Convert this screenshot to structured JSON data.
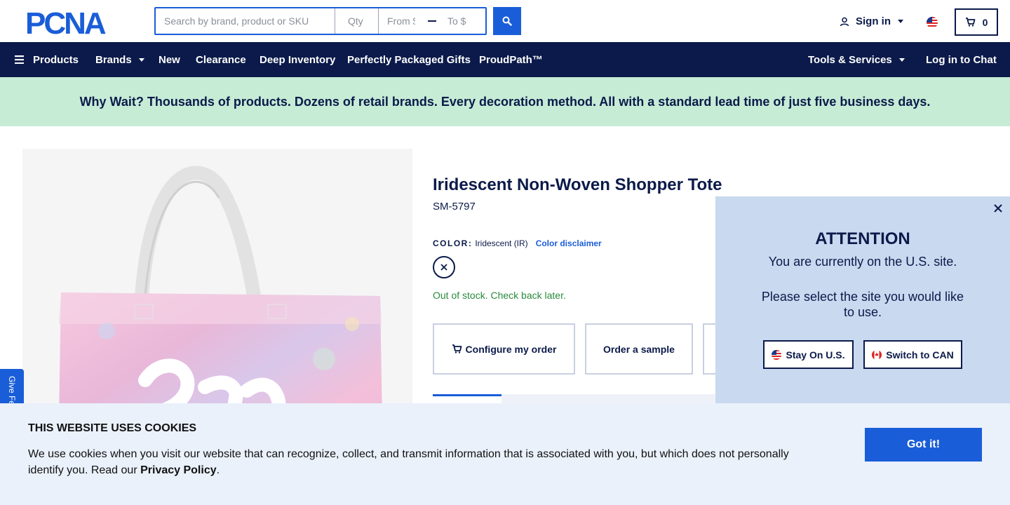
{
  "header": {
    "logo_text": "PCNA",
    "search_placeholder": "Search by brand, product or SKU",
    "qty_placeholder": "Qty",
    "from_placeholder": "From $",
    "to_placeholder": "To $",
    "sign_in": "Sign in",
    "cart_count": "0"
  },
  "nav": {
    "products": "Products",
    "brands": "Brands",
    "new": "New",
    "clearance": "Clearance",
    "deep_inventory": "Deep Inventory",
    "gifts": "Perfectly Packaged Gifts",
    "proudpath": "ProudPath™",
    "tools": "Tools & Services",
    "chat": "Log in to Chat"
  },
  "banner": {
    "text": "Why Wait? Thousands of products. Dozens of retail brands. Every decoration method. All with a standard lead time of just five business days."
  },
  "product": {
    "title": "Iridescent Non-Woven Shopper Tote",
    "sku": "SM-5797",
    "color_label": "COLOR:",
    "color_value": "Iridescent (IR)",
    "color_disclaimer": "Color disclaimer",
    "stock_status": "Out of stock. Check back later.",
    "configure_button": "Configure my order",
    "sample_button": "Order a sample"
  },
  "attention": {
    "title": "ATTENTION",
    "line1": "You are currently on the U.S. site.",
    "line2": "Please select the site you would like to use.",
    "stay_button": "Stay On U.S.",
    "switch_button": "Switch to CAN"
  },
  "feedback": {
    "label": "Give Feedback"
  },
  "cookie": {
    "title": "THIS WEBSITE USES COOKIES",
    "body": "We use cookies when you visit our website that can recognize, collect, and transmit information that is associated with you, but which does not personally identify you. Read our ",
    "link": "Privacy Policy",
    "end": ".",
    "button": "Got it!"
  },
  "colors": {
    "navy": "#0b1a4a",
    "blue": "#1a5dd8",
    "banner_green": "#c6ecd5",
    "popup_blue": "#c9d9ef",
    "stock_green": "#2a8a3e"
  }
}
